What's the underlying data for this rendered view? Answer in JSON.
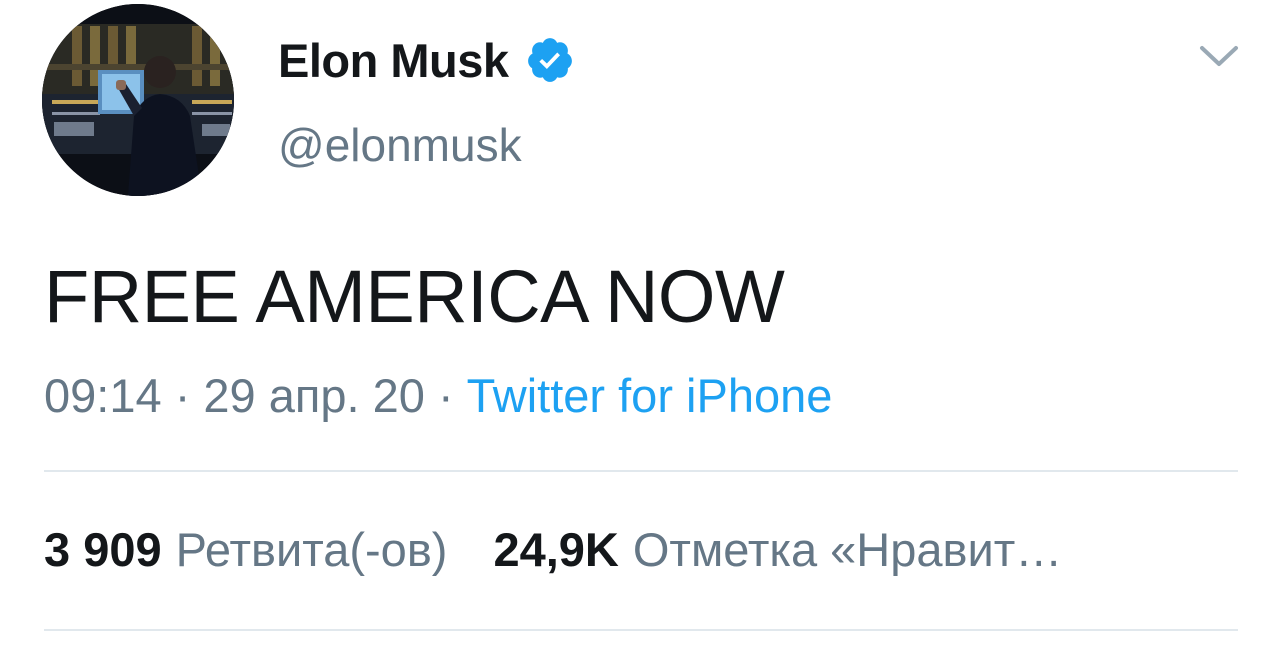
{
  "user": {
    "display_name": "Elon Musk",
    "handle": "@elonmusk",
    "verified": true,
    "verified_color": "#1da1f2"
  },
  "tweet": {
    "text": "FREE AMERICA NOW",
    "time": "09:14",
    "separator": "·",
    "date": "29 апр. 20",
    "source": "Twitter for iPhone"
  },
  "stats": {
    "retweets_count": "3 909",
    "retweets_label": "Ретвита(-ов)",
    "likes_count": "24,9K",
    "likes_label": "Отметка «Нравит…"
  },
  "icons": {
    "verified": "verified-badge-icon",
    "menu": "chevron-down-icon"
  },
  "colors": {
    "text_primary": "#14171a",
    "text_secondary": "#657786",
    "link": "#1da1f2",
    "divider": "#e1e8ed"
  }
}
